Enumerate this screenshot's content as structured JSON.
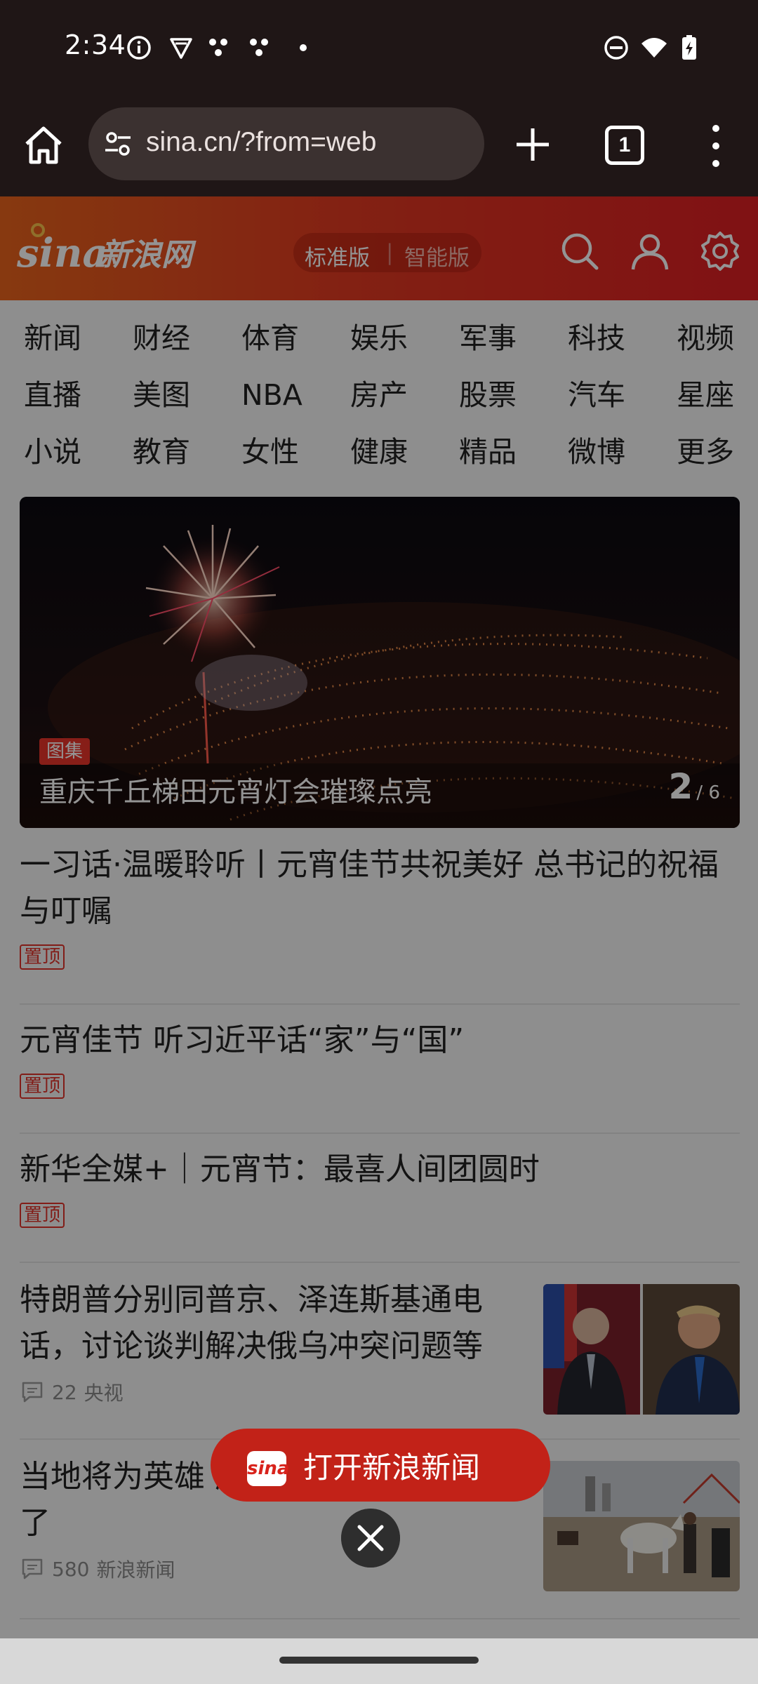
{
  "status_bar": {
    "time": "2:34",
    "left_icons": [
      "info-icon",
      "vpn-shield-icon",
      "dots-icon",
      "dots-icon",
      "small-dot-icon"
    ],
    "right_icons": [
      "do-not-disturb-icon",
      "wifi-icon",
      "battery-charging-icon"
    ]
  },
  "browser": {
    "url": "sina.cn/?from=web",
    "tab_count": "1"
  },
  "site": {
    "logo_text": "sina新浪网",
    "version_standard": "标准版",
    "version_separator": "|",
    "version_smart": "智能版",
    "brand_color": "#dd1e23"
  },
  "categories": [
    "新闻",
    "财经",
    "体育",
    "娱乐",
    "军事",
    "科技",
    "视频",
    "直播",
    "美图",
    "NBA",
    "房产",
    "股票",
    "汽车",
    "星座",
    "小说",
    "教育",
    "女性",
    "健康",
    "精品",
    "微博",
    "更多"
  ],
  "hero": {
    "tag": "图集",
    "caption": "重庆千丘梯田元宵灯会璀璨点亮",
    "page_current": "2",
    "page_total": "/ 6"
  },
  "news": [
    {
      "title": "一习话·温暖聆听丨元宵佳节共祝美好 总书记的祝福与叮嘱",
      "pin": "置顶"
    },
    {
      "title": "元宵佳节 听习近平话“家”与“国”",
      "pin": "置顶"
    },
    {
      "title": "新华全媒+｜元宵节：最喜人间团圆时",
      "pin": "置顶"
    },
    {
      "title": "特朗普分别同普京、泽连斯基通电话，讨论谈判解决俄乌冲突问题等",
      "comments": "22",
      "source": "央视"
    },
    {
      "title": "当地将为英雄 应其离世：我们尽力了",
      "comments": "580",
      "source": "新浪新闻"
    }
  ],
  "open_app": {
    "label": "打开新浪新闻",
    "logo": "sina"
  }
}
